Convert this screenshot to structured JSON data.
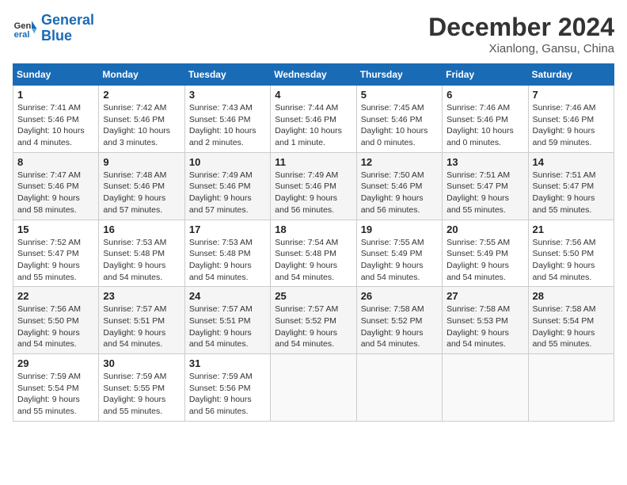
{
  "header": {
    "logo_line1": "General",
    "logo_line2": "Blue",
    "month": "December 2024",
    "location": "Xianlong, Gansu, China"
  },
  "weekdays": [
    "Sunday",
    "Monday",
    "Tuesday",
    "Wednesday",
    "Thursday",
    "Friday",
    "Saturday"
  ],
  "weeks": [
    [
      {
        "day": "1",
        "sunrise": "Sunrise: 7:41 AM",
        "sunset": "Sunset: 5:46 PM",
        "daylight": "Daylight: 10 hours and 4 minutes."
      },
      {
        "day": "2",
        "sunrise": "Sunrise: 7:42 AM",
        "sunset": "Sunset: 5:46 PM",
        "daylight": "Daylight: 10 hours and 3 minutes."
      },
      {
        "day": "3",
        "sunrise": "Sunrise: 7:43 AM",
        "sunset": "Sunset: 5:46 PM",
        "daylight": "Daylight: 10 hours and 2 minutes."
      },
      {
        "day": "4",
        "sunrise": "Sunrise: 7:44 AM",
        "sunset": "Sunset: 5:46 PM",
        "daylight": "Daylight: 10 hours and 1 minute."
      },
      {
        "day": "5",
        "sunrise": "Sunrise: 7:45 AM",
        "sunset": "Sunset: 5:46 PM",
        "daylight": "Daylight: 10 hours and 0 minutes."
      },
      {
        "day": "6",
        "sunrise": "Sunrise: 7:46 AM",
        "sunset": "Sunset: 5:46 PM",
        "daylight": "Daylight: 10 hours and 0 minutes."
      },
      {
        "day": "7",
        "sunrise": "Sunrise: 7:46 AM",
        "sunset": "Sunset: 5:46 PM",
        "daylight": "Daylight: 9 hours and 59 minutes."
      }
    ],
    [
      {
        "day": "8",
        "sunrise": "Sunrise: 7:47 AM",
        "sunset": "Sunset: 5:46 PM",
        "daylight": "Daylight: 9 hours and 58 minutes."
      },
      {
        "day": "9",
        "sunrise": "Sunrise: 7:48 AM",
        "sunset": "Sunset: 5:46 PM",
        "daylight": "Daylight: 9 hours and 57 minutes."
      },
      {
        "day": "10",
        "sunrise": "Sunrise: 7:49 AM",
        "sunset": "Sunset: 5:46 PM",
        "daylight": "Daylight: 9 hours and 57 minutes."
      },
      {
        "day": "11",
        "sunrise": "Sunrise: 7:49 AM",
        "sunset": "Sunset: 5:46 PM",
        "daylight": "Daylight: 9 hours and 56 minutes."
      },
      {
        "day": "12",
        "sunrise": "Sunrise: 7:50 AM",
        "sunset": "Sunset: 5:46 PM",
        "daylight": "Daylight: 9 hours and 56 minutes."
      },
      {
        "day": "13",
        "sunrise": "Sunrise: 7:51 AM",
        "sunset": "Sunset: 5:47 PM",
        "daylight": "Daylight: 9 hours and 55 minutes."
      },
      {
        "day": "14",
        "sunrise": "Sunrise: 7:51 AM",
        "sunset": "Sunset: 5:47 PM",
        "daylight": "Daylight: 9 hours and 55 minutes."
      }
    ],
    [
      {
        "day": "15",
        "sunrise": "Sunrise: 7:52 AM",
        "sunset": "Sunset: 5:47 PM",
        "daylight": "Daylight: 9 hours and 55 minutes."
      },
      {
        "day": "16",
        "sunrise": "Sunrise: 7:53 AM",
        "sunset": "Sunset: 5:48 PM",
        "daylight": "Daylight: 9 hours and 54 minutes."
      },
      {
        "day": "17",
        "sunrise": "Sunrise: 7:53 AM",
        "sunset": "Sunset: 5:48 PM",
        "daylight": "Daylight: 9 hours and 54 minutes."
      },
      {
        "day": "18",
        "sunrise": "Sunrise: 7:54 AM",
        "sunset": "Sunset: 5:48 PM",
        "daylight": "Daylight: 9 hours and 54 minutes."
      },
      {
        "day": "19",
        "sunrise": "Sunrise: 7:55 AM",
        "sunset": "Sunset: 5:49 PM",
        "daylight": "Daylight: 9 hours and 54 minutes."
      },
      {
        "day": "20",
        "sunrise": "Sunrise: 7:55 AM",
        "sunset": "Sunset: 5:49 PM",
        "daylight": "Daylight: 9 hours and 54 minutes."
      },
      {
        "day": "21",
        "sunrise": "Sunrise: 7:56 AM",
        "sunset": "Sunset: 5:50 PM",
        "daylight": "Daylight: 9 hours and 54 minutes."
      }
    ],
    [
      {
        "day": "22",
        "sunrise": "Sunrise: 7:56 AM",
        "sunset": "Sunset: 5:50 PM",
        "daylight": "Daylight: 9 hours and 54 minutes."
      },
      {
        "day": "23",
        "sunrise": "Sunrise: 7:57 AM",
        "sunset": "Sunset: 5:51 PM",
        "daylight": "Daylight: 9 hours and 54 minutes."
      },
      {
        "day": "24",
        "sunrise": "Sunrise: 7:57 AM",
        "sunset": "Sunset: 5:51 PM",
        "daylight": "Daylight: 9 hours and 54 minutes."
      },
      {
        "day": "25",
        "sunrise": "Sunrise: 7:57 AM",
        "sunset": "Sunset: 5:52 PM",
        "daylight": "Daylight: 9 hours and 54 minutes."
      },
      {
        "day": "26",
        "sunrise": "Sunrise: 7:58 AM",
        "sunset": "Sunset: 5:52 PM",
        "daylight": "Daylight: 9 hours and 54 minutes."
      },
      {
        "day": "27",
        "sunrise": "Sunrise: 7:58 AM",
        "sunset": "Sunset: 5:53 PM",
        "daylight": "Daylight: 9 hours and 54 minutes."
      },
      {
        "day": "28",
        "sunrise": "Sunrise: 7:58 AM",
        "sunset": "Sunset: 5:54 PM",
        "daylight": "Daylight: 9 hours and 55 minutes."
      }
    ],
    [
      {
        "day": "29",
        "sunrise": "Sunrise: 7:59 AM",
        "sunset": "Sunset: 5:54 PM",
        "daylight": "Daylight: 9 hours and 55 minutes."
      },
      {
        "day": "30",
        "sunrise": "Sunrise: 7:59 AM",
        "sunset": "Sunset: 5:55 PM",
        "daylight": "Daylight: 9 hours and 55 minutes."
      },
      {
        "day": "31",
        "sunrise": "Sunrise: 7:59 AM",
        "sunset": "Sunset: 5:56 PM",
        "daylight": "Daylight: 9 hours and 56 minutes."
      },
      null,
      null,
      null,
      null
    ]
  ]
}
